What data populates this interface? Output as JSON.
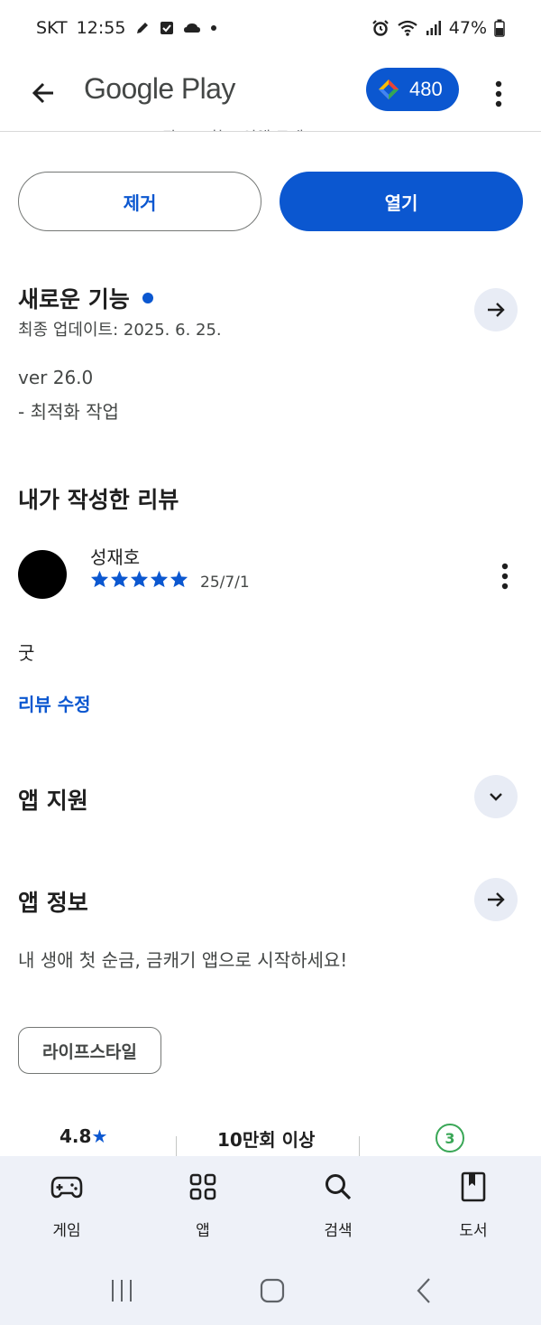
{
  "status_bar": {
    "carrier": "SKT",
    "time": "12:55",
    "battery": "47%"
  },
  "app_bar": {
    "title": "Google Play",
    "points": "480",
    "cut_off_text": "광고 포함 • 인앱 구매"
  },
  "actions": {
    "remove_label": "제거",
    "open_label": "열기"
  },
  "whats_new": {
    "title": "새로운 기능",
    "last_updated": "최종 업데이트: 2025. 6. 25.",
    "version": "ver 26.0",
    "notes": "- 최적화 작업"
  },
  "my_review": {
    "title": "내가 작성한 리뷰",
    "reviewer": "성재호",
    "rating": 5,
    "date": "25/7/1",
    "text": "굿",
    "edit_label": "리뷰 수정"
  },
  "app_support": {
    "title": "앱 지원"
  },
  "app_info": {
    "title": "앱 정보",
    "description": "내 생애 첫 순금, 금캐기 앱으로 시작하세요!",
    "category": "라이프스타일"
  },
  "stats": {
    "rating": "4.8",
    "downloads": "10만회 이상",
    "age_rating": "3"
  },
  "bottom_nav": {
    "games": "게임",
    "apps": "앱",
    "search": "검색",
    "books": "도서"
  },
  "colors": {
    "accent": "#0b57d0",
    "chip_bg": "#e8ecf5",
    "nav_bg": "#eef1f8",
    "age_green": "#3aa757"
  }
}
